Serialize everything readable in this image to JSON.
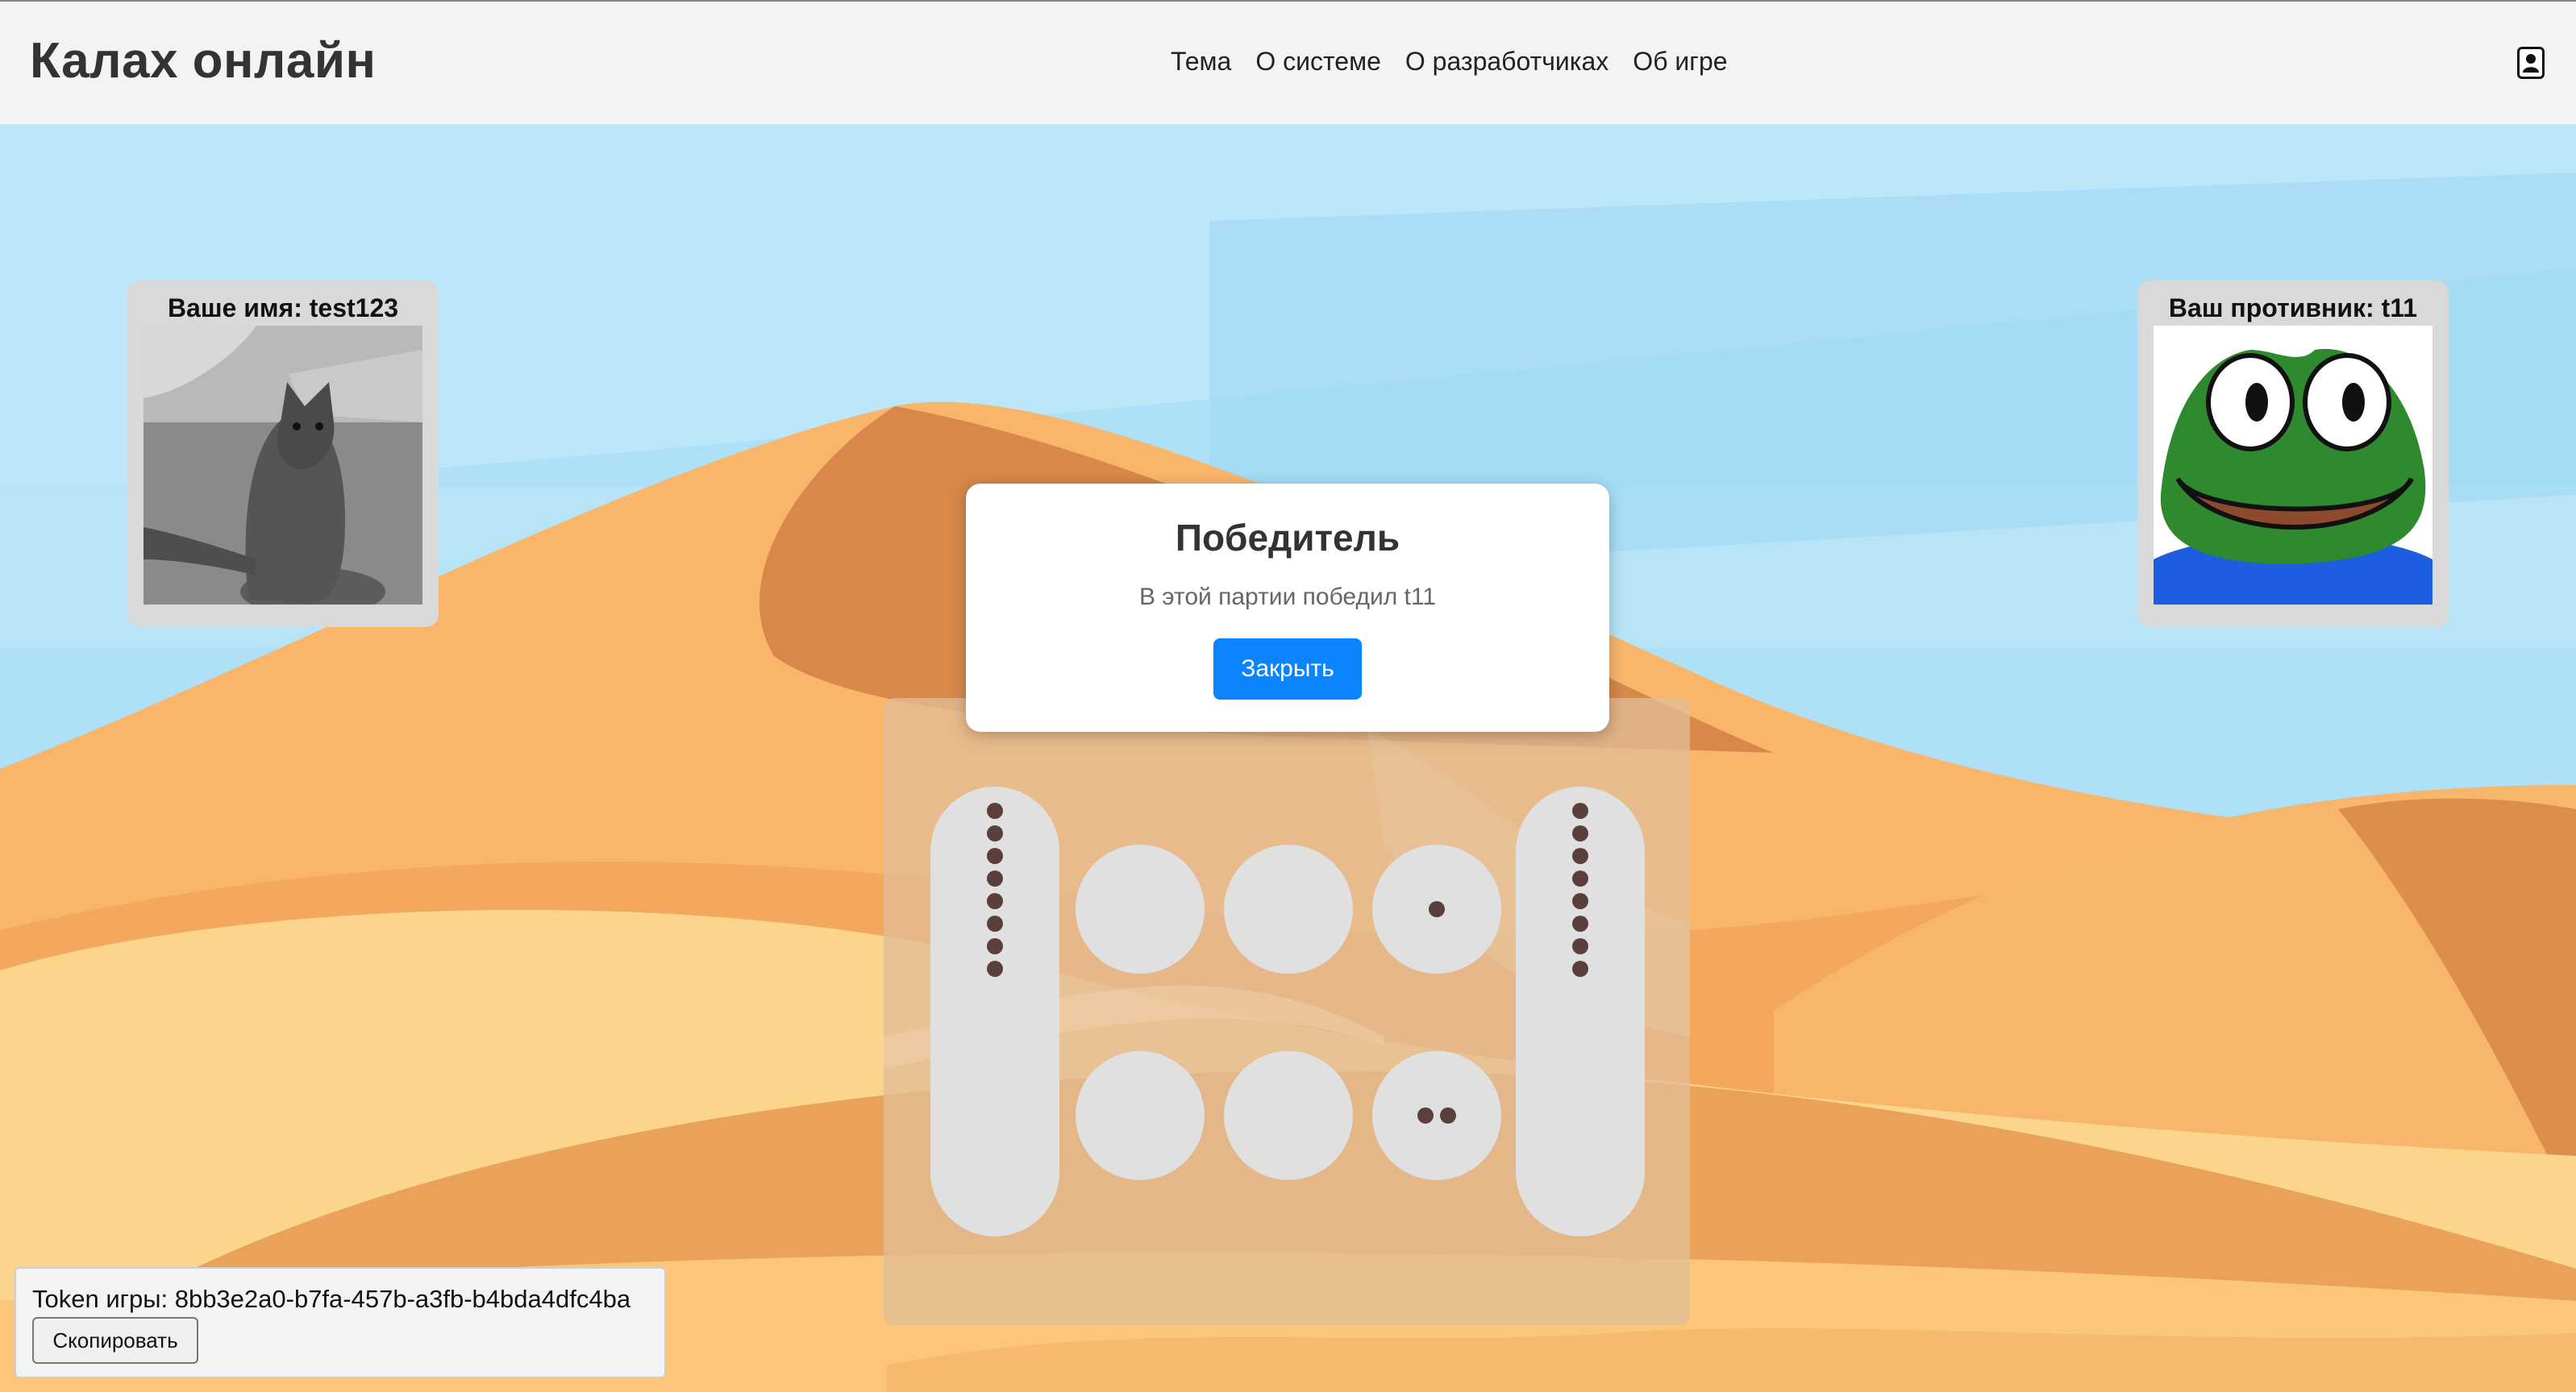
{
  "header": {
    "logo": "Калах онлайн",
    "nav": [
      "Тема",
      "О системе",
      "О разработчиках",
      "Об игре"
    ],
    "user_icon": "user-circle-icon"
  },
  "players": {
    "me": {
      "label": "Ваше имя: test123",
      "avatar": "cat-photo"
    },
    "opponent": {
      "label": "Ваш противник: t11",
      "avatar": "frog-meme"
    }
  },
  "modal": {
    "title": "Победитель",
    "text": "В этой партии победил t11",
    "button": "Закрыть"
  },
  "board": {
    "left_kalah_stones": 8,
    "right_kalah_stones": 8,
    "top_pits": [
      0,
      0,
      1
    ],
    "bottom_pits": [
      0,
      0,
      2
    ]
  },
  "token": {
    "label": "Token игры: 8bb3e2a0-b7fa-457b-a3fb-b4bda4dfc4ba",
    "copy_button": "Скопировать"
  },
  "colors": {
    "sky": "#aee0f7",
    "dune_orange": "#f9b66b",
    "dune_dark": "#d7884a",
    "accent": "#0a84ff"
  }
}
